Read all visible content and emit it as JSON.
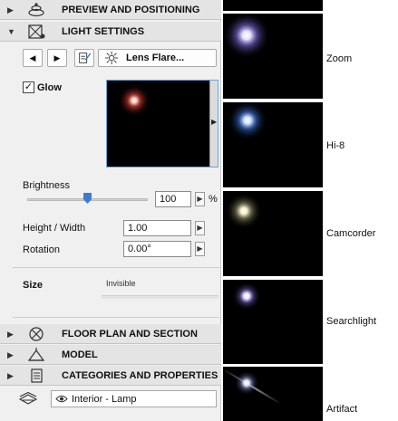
{
  "sections": {
    "preview": "PREVIEW AND POSITIONING",
    "light": "LIGHT SETTINGS",
    "floor": "FLOOR PLAN AND SECTION",
    "model": "MODEL",
    "categories": "CATEGORIES AND PROPERTIES"
  },
  "toolbar": {
    "prev_icon": "triangle-left-icon",
    "next_icon": "triangle-right-icon",
    "edit_icon": "edit-document-icon",
    "flare_icon": "sparkle-icon",
    "flare_label": "Lens Flare..."
  },
  "glow": {
    "label": "Glow",
    "checked": true,
    "check_mark": "✓"
  },
  "brightness": {
    "label": "Brightness",
    "value": "100",
    "unit": "%",
    "level": 0.5
  },
  "height_width": {
    "label": "Height / Width",
    "value": "1.00"
  },
  "rotation": {
    "label": "Rotation",
    "value": "0.00°"
  },
  "size": {
    "label": "Size",
    "scale_label": "Invisible"
  },
  "favorite": {
    "label": "Interior - Lamp"
  },
  "presets": [
    "Zoom",
    "Hi-8",
    "Camcorder",
    "Searchlight",
    "Artifact"
  ],
  "colors": {
    "panel_bg": "#f0f0f0",
    "header_bg": "#e4e4e4",
    "accent": "#3b7bd6",
    "glow_red": "#ff6a5a",
    "zoom_violet": "#b8a8ff",
    "hi8_blue": "#7fb2ff",
    "camcorder_yellow": "#e8e4b0",
    "searchlight_violet": "#d8c8ff",
    "artifact_white": "#e8e8ff"
  }
}
